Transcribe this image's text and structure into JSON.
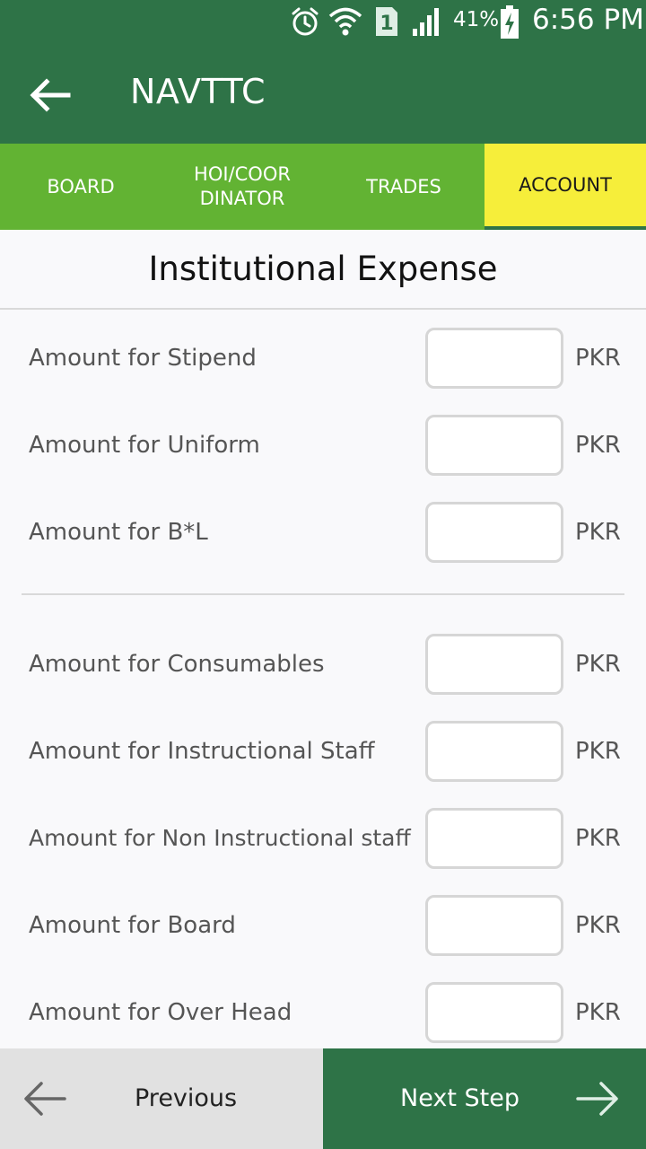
{
  "status_bar": {
    "battery": "41%",
    "time": "6:56 PM",
    "sim_badge": "1",
    "icons": [
      "alarm-icon",
      "wifi-icon",
      "sim-icon",
      "signal-icon",
      "battery-charging-icon"
    ]
  },
  "app_bar": {
    "title": "NAVTTC",
    "back_icon": "back-arrow-icon"
  },
  "tabs": [
    {
      "label": "BOARD"
    },
    {
      "label": "HOI/COOR DINATOR"
    },
    {
      "label": "TRADES"
    },
    {
      "label": "ACCOUNT"
    }
  ],
  "section_title": "Institutional Expense",
  "unit": "PKR",
  "group1": [
    {
      "label": "Amount for Stipend",
      "value": ""
    },
    {
      "label": "Amount for Uniform",
      "value": ""
    },
    {
      "label": "Amount for B*L",
      "value": ""
    }
  ],
  "group2": [
    {
      "label": "Amount for Consumables",
      "value": ""
    },
    {
      "label": "Amount for Instructional Staff",
      "value": ""
    },
    {
      "label": "Amount for Non Instructional staff",
      "value": ""
    },
    {
      "label": "Amount for Board",
      "value": ""
    },
    {
      "label": "Amount for Over Head",
      "value": ""
    }
  ],
  "bottom": {
    "previous": "Previous",
    "next": "Next Step"
  },
  "colors": {
    "primary": "#2e7347",
    "tab_bar": "#62b333",
    "active_tab": "#f6ee3a"
  }
}
